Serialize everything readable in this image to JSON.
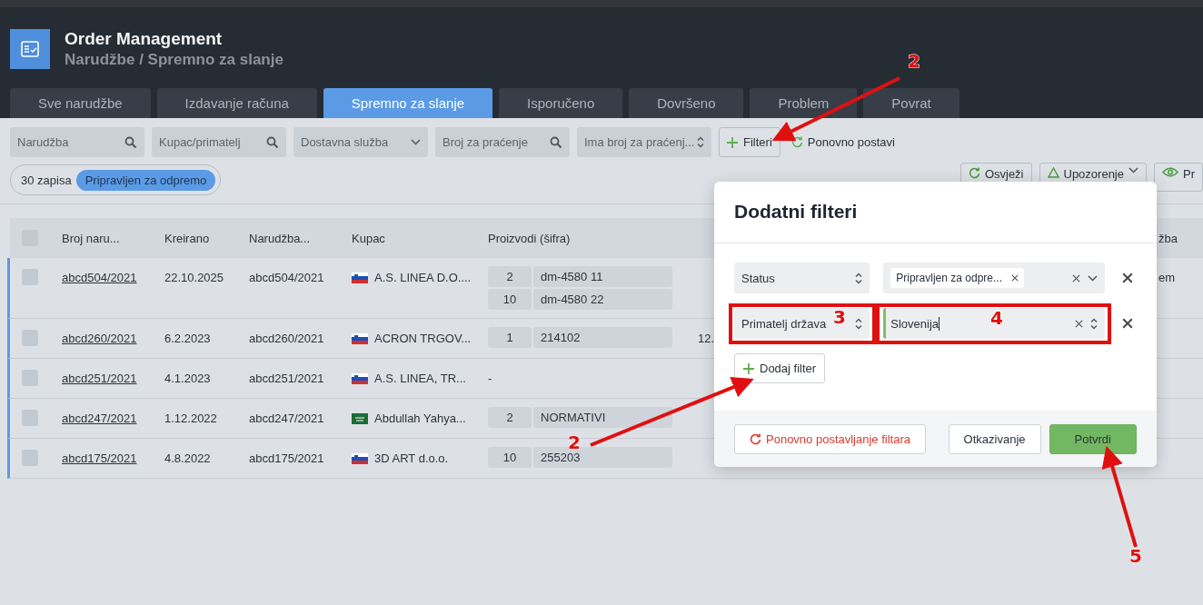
{
  "app": {
    "title": "Order Management",
    "breadcrumb": "Narudžbe / Spremno za slanje"
  },
  "tabs": [
    {
      "label": "Sve narudžbe",
      "selected": false
    },
    {
      "label": "Izdavanje računa",
      "selected": false
    },
    {
      "label": "Spremno za slanje",
      "selected": true
    },
    {
      "label": "Isporučeno",
      "selected": false
    },
    {
      "label": "Dovršeno",
      "selected": false
    },
    {
      "label": "Problem",
      "selected": false
    },
    {
      "label": "Povrat",
      "selected": false
    }
  ],
  "filters": [
    {
      "kind": "search",
      "placeholder": "Narudžba"
    },
    {
      "kind": "search",
      "placeholder": "Kupac/primatelj"
    },
    {
      "kind": "dropdown",
      "placeholder": "Dostavna služba"
    },
    {
      "kind": "search",
      "placeholder": "Broj za praćenje"
    },
    {
      "kind": "select",
      "placeholder": "Ima broj za praćenj..."
    }
  ],
  "filters_button": "Filteri",
  "reset_link": "Ponovno postavi",
  "record_count": "30 zapisa",
  "active_chip": "Pripravljen za odpremo",
  "actions": [
    {
      "kind": "refresh",
      "label": "Osvježi"
    },
    {
      "kind": "warning",
      "label": "Upozorenje"
    },
    {
      "kind": "eye",
      "label": "Pr"
    }
  ],
  "table": {
    "header_checked": false,
    "columns": [
      "Broj naru...",
      "Kreirano",
      "Narudžba...",
      "Kupac",
      "Proizvodi (šifra)",
      "žba"
    ],
    "rows": [
      {
        "checked": false,
        "number": "abcd504/2021",
        "created": "22.10.2025",
        "order": "abcd504/2021",
        "kind": "si",
        "customer": "A.S. LINEA D.O....",
        "products": [
          {
            "qty": "2",
            "code": "dm-4580 11"
          },
          {
            "qty": "10",
            "code": "dm-4580 22"
          }
        ],
        "column_7": "em"
      },
      {
        "checked": false,
        "number": "abcd260/2021",
        "created": "6.2.2023",
        "order": "abcd260/2021",
        "kind": "si",
        "customer": "ACRON TRGOV...",
        "products": [
          {
            "qty": "1",
            "code": "214102"
          }
        ],
        "column_6": "12."
      },
      {
        "checked": false,
        "number": "abcd251/2021",
        "created": "4.1.2023",
        "order": "abcd251/2021",
        "kind": "si",
        "customer": "A.S. LINEA, TR...",
        "products": [],
        "empty_products": "-"
      },
      {
        "checked": false,
        "number": "abcd247/2021",
        "created": "1.12.2022",
        "order": "abcd247/2021",
        "kind": "sa",
        "customer": "Abdullah Yahya...",
        "products": [
          {
            "qty": "2",
            "code": "NORMATIVI"
          }
        ]
      },
      {
        "checked": false,
        "number": "abcd175/2021",
        "created": "4.8.2022",
        "order": "abcd175/2021",
        "kind": "si",
        "customer": "3D ART d.o.o.",
        "products": [
          {
            "qty": "10",
            "code": "255203"
          }
        ]
      }
    ]
  },
  "modal": {
    "title": "Dodatni filteri",
    "rows": [
      {
        "field": "Status",
        "kind": "chips",
        "chip": "Pripravljen za odpre...",
        "focused": false
      },
      {
        "field": "Primatelj država",
        "kind": "input",
        "value": "Slovenija",
        "focused": true
      }
    ],
    "add_button": "Dodaj filter",
    "reset_button": "Ponovno postavljanje filtara",
    "cancel_button": "Otkazivanje",
    "confirm_button": "Potvrdi"
  },
  "annotations": [
    {
      "text": "2"
    },
    {
      "text": "3"
    },
    {
      "text": "4"
    },
    {
      "text": "2"
    },
    {
      "text": "5"
    }
  ]
}
